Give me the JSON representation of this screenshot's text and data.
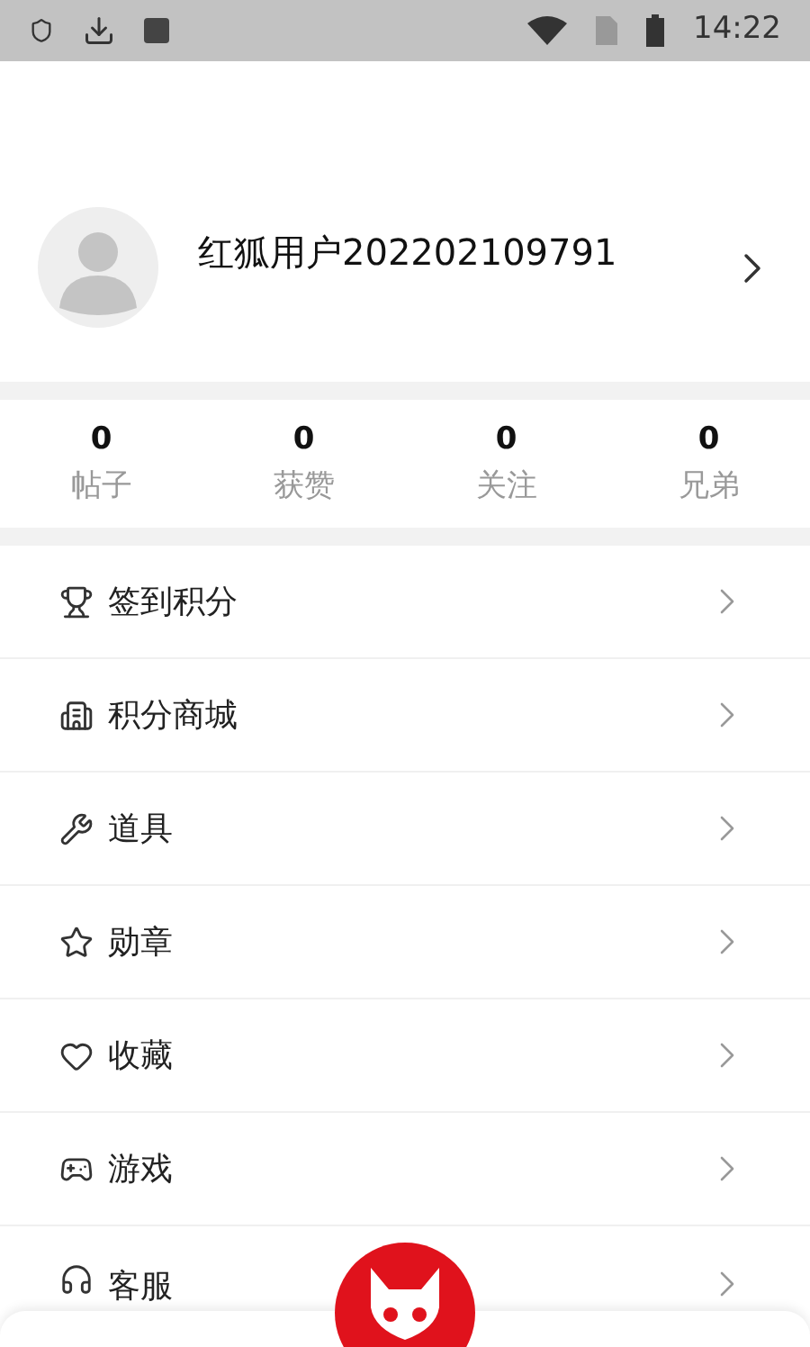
{
  "status_bar": {
    "time": "14:22"
  },
  "profile": {
    "username": "红狐用户202202109791"
  },
  "stats": [
    {
      "value": "0",
      "label": "帖子"
    },
    {
      "value": "0",
      "label": "获赞"
    },
    {
      "value": "0",
      "label": "关注"
    },
    {
      "value": "0",
      "label": "兄弟"
    }
  ],
  "menu": [
    {
      "label": "签到积分",
      "kind": "trophy"
    },
    {
      "label": "积分商城",
      "kind": "store"
    },
    {
      "label": "道具",
      "kind": "wrench"
    },
    {
      "label": "勋章",
      "kind": "star"
    },
    {
      "label": "收藏",
      "kind": "heart"
    },
    {
      "label": "游戏",
      "kind": "gamepad"
    },
    {
      "label": "客服",
      "kind": "headset"
    }
  ]
}
